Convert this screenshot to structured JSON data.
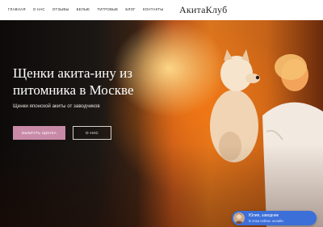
{
  "header": {
    "nav": [
      "Главная",
      "О нас",
      "Отзывы",
      "Белые",
      "Тигровые",
      "Блог",
      "Контакты"
    ],
    "logo": "АкитаКлуб"
  },
  "hero": {
    "title": "Щенки акита-ину из питомника в Москве",
    "subtitle": "Щенки японской акиты от заводчиков",
    "primary_button": "Выбрать щенка",
    "secondary_button": "О нас"
  },
  "chat_widget": {
    "name": "Юлия, заводчик",
    "status": "В этом сейчас онлайн"
  },
  "colors": {
    "accent": "#c98aa8",
    "chat": "#3c6fd8"
  }
}
